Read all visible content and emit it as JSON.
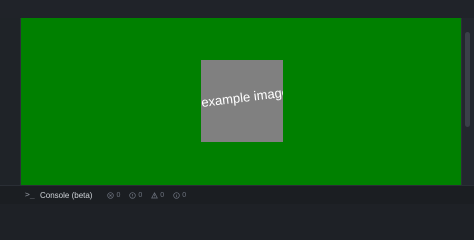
{
  "preview": {
    "background_color": "#008000",
    "image_label": "example image",
    "image_color": "#808080"
  },
  "console": {
    "title": "Console (beta)",
    "counters": [
      {
        "icon": "error-circle-icon",
        "value": "0"
      },
      {
        "icon": "warning-circle-icon",
        "value": "0"
      },
      {
        "icon": "warning-triangle-icon",
        "value": "0"
      },
      {
        "icon": "info-circle-icon",
        "value": "0"
      }
    ]
  }
}
